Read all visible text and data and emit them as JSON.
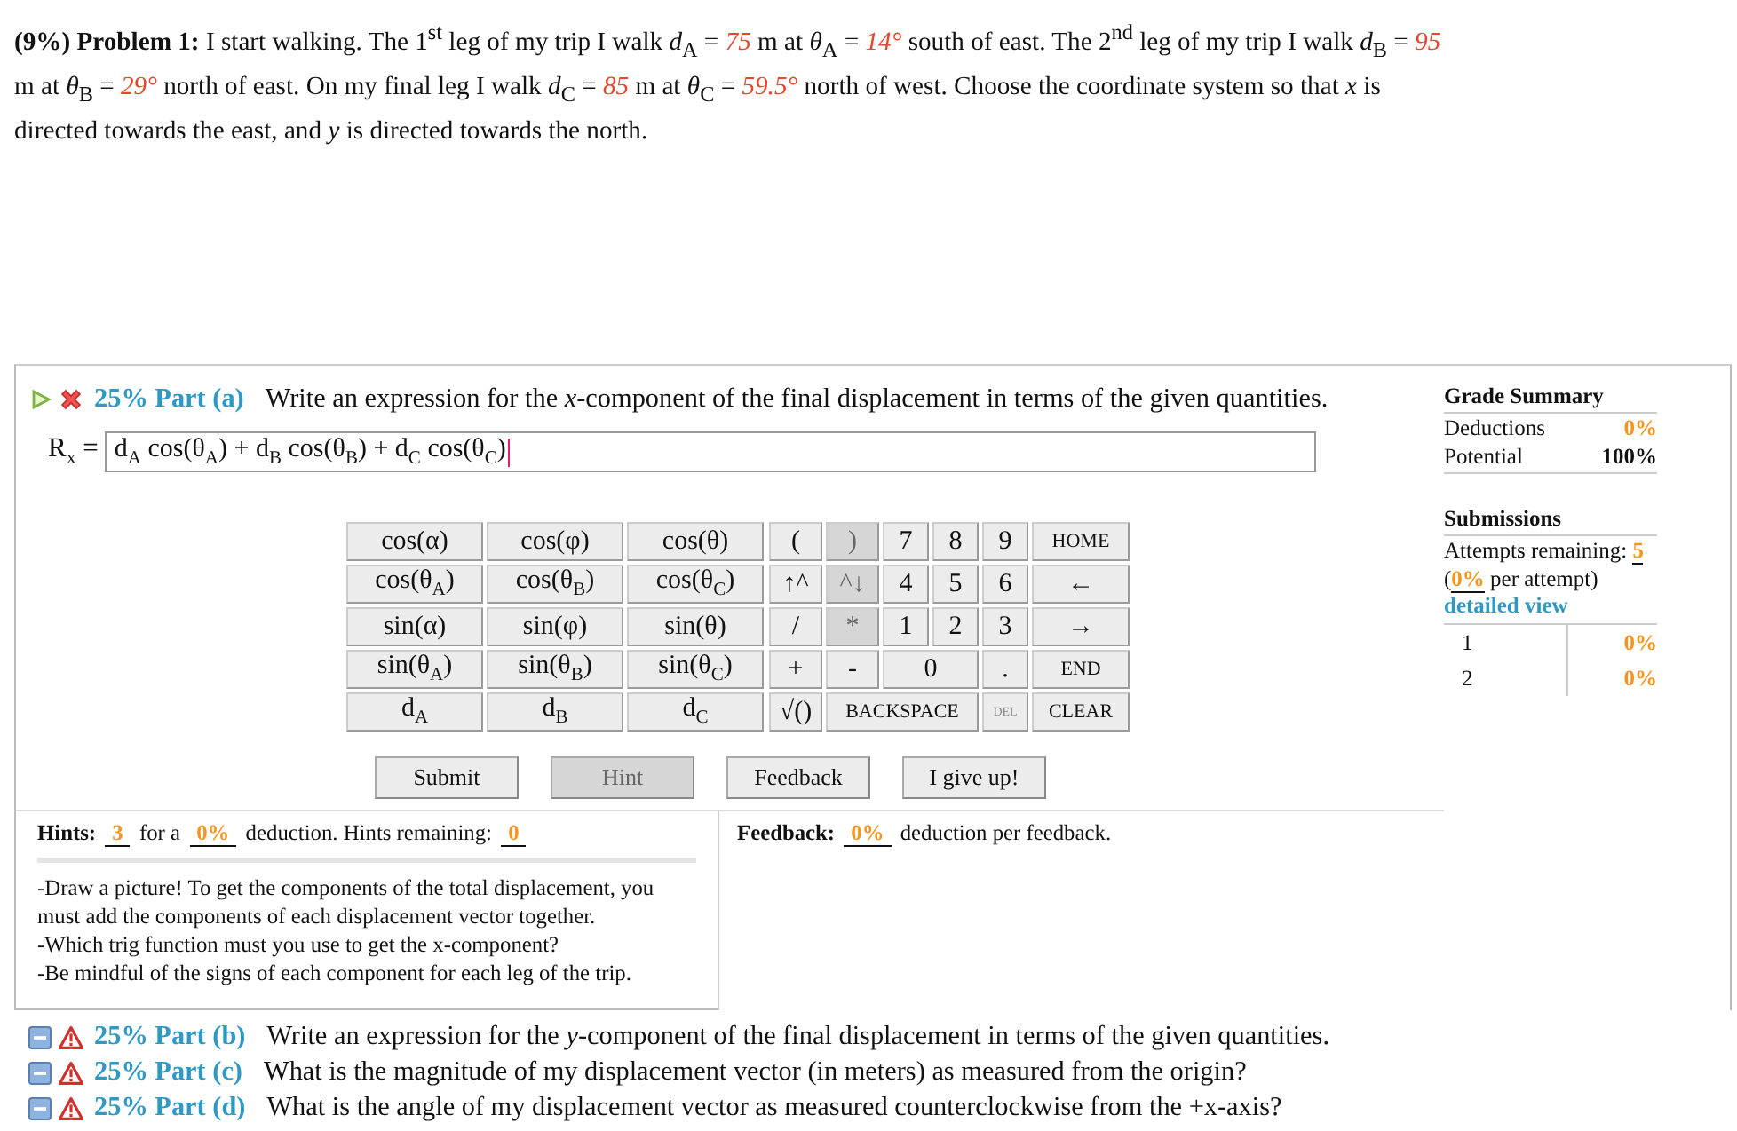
{
  "problem": {
    "segments": [
      {
        "kind": "text",
        "t": "**(9%) Problem 1:** I start walking. The 1$^{st}$ leg of my trip I walk *d*$_{A}$ = "
      },
      {
        "kind": "given",
        "t": "75"
      },
      {
        "kind": "text",
        "t": " m at *θ*$_{A}$ = "
      },
      {
        "kind": "given",
        "t": "14°"
      },
      {
        "kind": "text",
        "t": " south of east. The 2$^{nd}$ leg of my trip I walk *d*$_{B}$ = "
      },
      {
        "kind": "given",
        "t": "95"
      },
      {
        "kind": "text",
        "t": " m at *θ*$_{B}$ = "
      },
      {
        "kind": "given",
        "t": "29°"
      },
      {
        "kind": "text",
        "t": " north of east. On my final leg I walk *d*$_{C}$ = "
      },
      {
        "kind": "given",
        "t": "85"
      },
      {
        "kind": "text",
        "t": " m at *θ*$_{C}$ = "
      },
      {
        "kind": "given",
        "t": "59.5°"
      },
      {
        "kind": "text",
        "t": " north of west. Choose the coordinate system so that *x* is directed towards the east, and *y* is directed towards the north."
      }
    ]
  },
  "part_a": {
    "expanded": true,
    "kind": "incorrect",
    "weight": "25% Part (a)",
    "question": "Write an expression for the *x*-component of the final displacement in terms of the given quantities.",
    "answer_label": "R$_{x}$ =",
    "answer": "d$_{A}$ cos(θ$_{A}$) + d$_{B}$ cos(θ$_{B}$) + d$_{C}$ cos(θ$_{C}$)",
    "function_keys": [
      [
        "cos(α)",
        "cos(φ)",
        "cos(θ)"
      ],
      [
        "cos(θ$_{A}$)",
        "cos(θ$_{B}$)",
        "cos(θ$_{C}$)"
      ],
      [
        "sin(α)",
        "sin(φ)",
        "sin(θ)"
      ],
      [
        "sin(θ$_{A}$)",
        "sin(θ$_{B}$)",
        "sin(θ$_{C}$)"
      ],
      [
        "d$_{A}$",
        "d$_{B}$",
        "d$_{C}$"
      ]
    ],
    "keys": [
      [
        {
          "label": "(",
          "kind": "key",
          "disabled": false
        },
        {
          "label": ")",
          "kind": "key",
          "disabled": true
        },
        {
          "label": "7",
          "kind": "key",
          "disabled": false
        },
        {
          "label": "8",
          "kind": "key",
          "disabled": false
        },
        {
          "label": "9",
          "kind": "key",
          "disabled": false
        },
        {
          "label": "HOME",
          "kind": "small-key",
          "disabled": false
        }
      ],
      [
        {
          "label": "↑^",
          "kind": "key",
          "disabled": false
        },
        {
          "label": "^↓",
          "kind": "key",
          "disabled": true
        },
        {
          "label": "4",
          "kind": "key",
          "disabled": false
        },
        {
          "label": "5",
          "kind": "key",
          "disabled": false
        },
        {
          "label": "6",
          "kind": "key",
          "disabled": false
        },
        {
          "label": "←",
          "kind": "key",
          "disabled": false
        }
      ],
      [
        {
          "label": "/",
          "kind": "key",
          "disabled": false
        },
        {
          "label": "*",
          "kind": "key",
          "disabled": true
        },
        {
          "label": "1",
          "kind": "key",
          "disabled": false
        },
        {
          "label": "2",
          "kind": "key",
          "disabled": false
        },
        {
          "label": "3",
          "kind": "key",
          "disabled": false
        },
        {
          "label": "→",
          "kind": "key",
          "disabled": false
        }
      ],
      [
        {
          "label": "+",
          "kind": "key",
          "disabled": false
        },
        {
          "label": "-",
          "kind": "key",
          "disabled": false
        },
        {
          "label": "0",
          "kind": "wide-key",
          "disabled": false
        },
        {
          "label": ".",
          "kind": "key",
          "disabled": false
        },
        {
          "label": "END",
          "kind": "small-key",
          "disabled": false
        }
      ],
      [
        {
          "label": "√()",
          "kind": "key",
          "disabled": false
        },
        {
          "label": "BACKSPACE",
          "kind": "long-key",
          "disabled": false
        },
        {
          "label": "DEL",
          "kind": "tiny-key",
          "disabled": false
        },
        {
          "label": "CLEAR",
          "kind": "small-key",
          "disabled": false
        }
      ]
    ],
    "buttons": [
      {
        "label": "Submit",
        "disabled": false
      },
      {
        "label": "Hint",
        "disabled": true
      },
      {
        "label": "Feedback",
        "disabled": false
      },
      {
        "label": "I give up!",
        "disabled": false
      }
    ],
    "hints": {
      "summary": [
        {
          "kind": "text",
          "t": "**Hints:** "
        },
        {
          "kind": "score",
          "t": "3"
        },
        {
          "kind": "text",
          "t": " for a "
        },
        {
          "kind": "score",
          "t": "0%"
        },
        {
          "kind": "text",
          "t": " deduction. Hints remaining: "
        },
        {
          "kind": "score",
          "t": "0"
        }
      ],
      "items": [
        "-Draw a picture! To get the components of the total displacement, you must add the components of each displacement vector together.",
        "-Which trig function must you use to get the x-component?",
        "-Be mindful of the signs of each component for each leg of the trip."
      ]
    },
    "feedback": [
      {
        "kind": "text",
        "t": "**Feedback:** "
      },
      {
        "kind": "score",
        "t": "0%"
      },
      {
        "kind": "text",
        "t": " deduction per feedback."
      }
    ],
    "grade_summary": {
      "title": "Grade Summary",
      "rows": [
        {
          "label": "Deductions",
          "value": "0%",
          "kind": "accent"
        },
        {
          "label": "Potential",
          "value": "100%",
          "kind": "strong"
        }
      ]
    },
    "submissions": {
      "title": "Submissions",
      "attempts": [
        {
          "kind": "text",
          "t": "Attempts remaining: "
        },
        {
          "kind": "score",
          "t": "5"
        },
        {
          "kind": "text",
          "t": " ("
        },
        {
          "kind": "score",
          "t": "0%"
        },
        {
          "kind": "text",
          "t": " per attempt)"
        }
      ],
      "link": "detailed view",
      "rows": [
        {
          "number": "1",
          "value": "0%"
        },
        {
          "number": "2",
          "value": "0%"
        }
      ]
    }
  },
  "other_parts": [
    {
      "expanded": false,
      "kind": "warning",
      "weight": "25% Part (b)",
      "question": "Write an expression for the *y*-component of the final displacement in terms of the given quantities."
    },
    {
      "expanded": false,
      "kind": "warning",
      "weight": "25% Part (c)",
      "question": "What is the magnitude of my displacement vector (in meters) as measured from the origin?"
    },
    {
      "expanded": false,
      "kind": "warning",
      "weight": "25% Part (d)",
      "question": "What is the angle of my displacement vector as measured counterclockwise from the +x-axis?"
    }
  ]
}
